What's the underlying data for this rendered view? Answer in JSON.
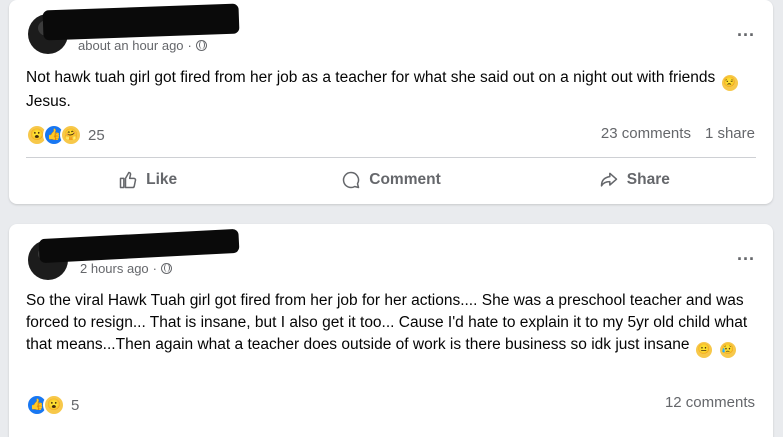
{
  "posts": [
    {
      "timestamp": "about an hour ago",
      "text_main": "Not hawk tuah girl got fired from her job as a teacher for what she said out on a night out with friends",
      "text_end": "Jesus.",
      "reaction_count": "25",
      "reactions": [
        "wow",
        "like",
        "care"
      ],
      "comments": "23 comments",
      "shares": "1 share",
      "more": "..."
    },
    {
      "timestamp": "2 hours ago",
      "text_main": "So the viral Hawk Tuah girl got fired from her job for her actions.... She was a preschool teacher and was forced to resign... That is insane, but I also get it too... Cause I'd hate to explain it to my 5yr old child what that means...Then again what a teacher does outside of work is there business so idk just insane",
      "reaction_count": "5",
      "reactions": [
        "like",
        "wow"
      ],
      "comments": "12 comments",
      "more": "..."
    }
  ],
  "actions": {
    "like": "Like",
    "comment": "Comment",
    "share": "Share"
  },
  "colors": {
    "like_blue": "#1877f2",
    "wow_yellow": "#f7c84a",
    "muted_text": "#65676b",
    "page_bg": "#e9ebee"
  }
}
